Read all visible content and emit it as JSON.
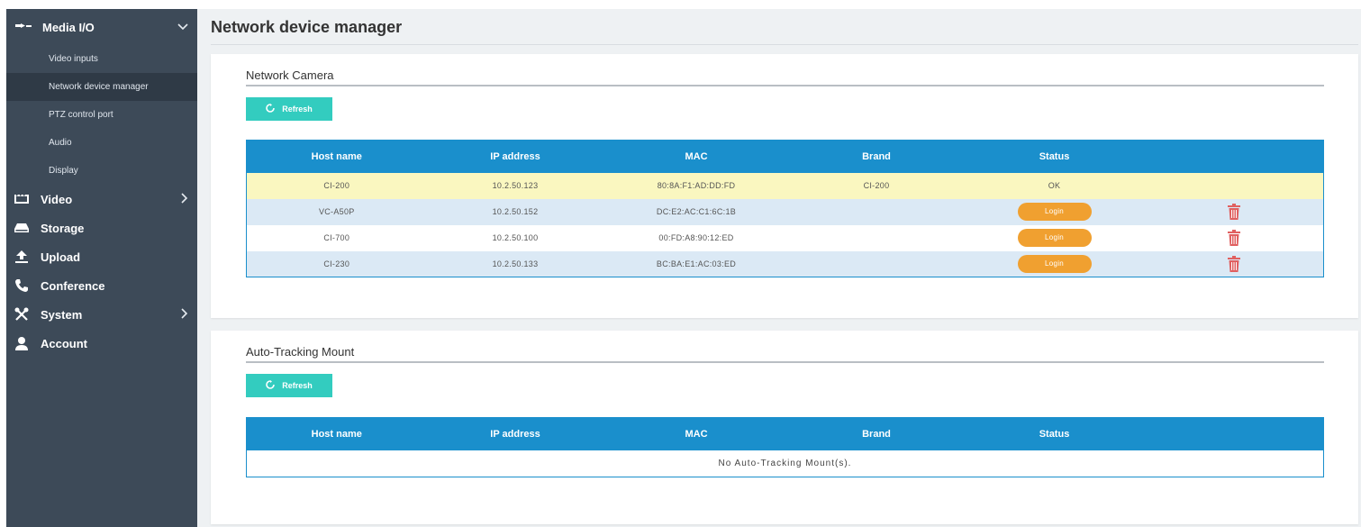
{
  "sidebar": {
    "media_io": {
      "label": "Media I/O",
      "icon": "media-io-icon",
      "chevron": "chevron-down-icon"
    },
    "media_sub": [
      {
        "label": "Video inputs"
      },
      {
        "label": "Network device manager",
        "active": true
      },
      {
        "label": "PTZ control port"
      },
      {
        "label": "Audio"
      },
      {
        "label": "Display"
      }
    ],
    "items": [
      {
        "label": "Video",
        "icon": "video-icon",
        "chevron": true
      },
      {
        "label": "Storage",
        "icon": "storage-icon"
      },
      {
        "label": "Upload",
        "icon": "upload-icon"
      },
      {
        "label": "Conference",
        "icon": "phone-icon"
      },
      {
        "label": "System",
        "icon": "tools-icon",
        "chevron": true
      },
      {
        "label": "Account",
        "icon": "user-icon"
      }
    ]
  },
  "page": {
    "title": "Network device manager"
  },
  "network_camera": {
    "title": "Network Camera",
    "refresh_label": "Refresh",
    "columns": [
      "Host name",
      "IP address",
      "MAC",
      "Brand",
      "Status"
    ],
    "rows": [
      {
        "host": "CI-200",
        "ip": "10.2.50.123",
        "mac": "80:8A:F1:AD:DD:FD",
        "brand": "CI-200",
        "status": "OK"
      },
      {
        "host": "VC-A50P",
        "ip": "10.2.50.152",
        "mac": "DC:E2:AC:C1:6C:1B",
        "brand": "",
        "status": "Login"
      },
      {
        "host": "CI-700",
        "ip": "10.2.50.100",
        "mac": "00:FD:A8:90:12:ED",
        "brand": "",
        "status": "Login"
      },
      {
        "host": "CI-230",
        "ip": "10.2.50.133",
        "mac": "BC:BA:E1:AC:03:ED",
        "brand": "",
        "status": "Login"
      }
    ]
  },
  "auto_tracking": {
    "title": "Auto-Tracking Mount",
    "refresh_label": "Refresh",
    "columns": [
      "Host name",
      "IP address",
      "MAC",
      "Brand",
      "Status"
    ],
    "empty_text": "No Auto-Tracking Mount(s)."
  },
  "colors": {
    "sidebar_bg": "#3d4a58",
    "accent_teal": "#33ccbf",
    "table_header": "#1a8fcc",
    "login_orange": "#f0a030",
    "delete_red": "#e06060",
    "row_highlight": "#faf7c0",
    "row_alt": "#dbe9f5"
  }
}
